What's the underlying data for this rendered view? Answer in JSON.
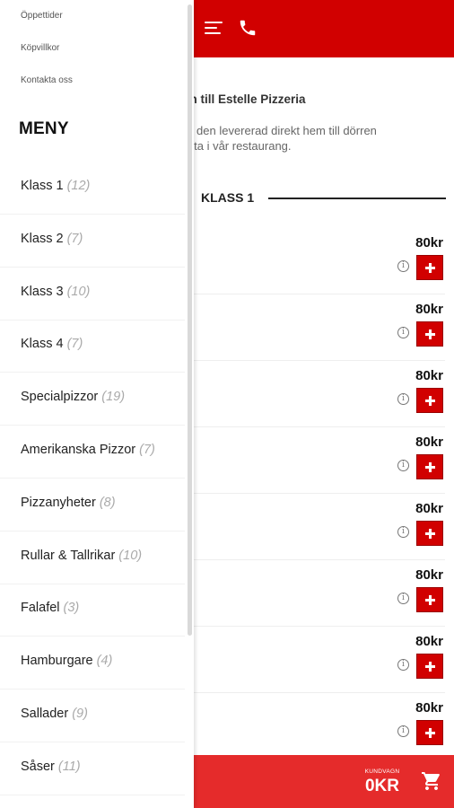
{
  "header": {
    "menu_icon": "hamburger-icon",
    "phone_icon": "phone-icon",
    "accent": "#d10000"
  },
  "welcome": {
    "title": "mmen till Estelle Pizzeria",
    "line1": "och få den levererad direkt hem till dörren",
    "line2": "tt hämta i vår restaurang."
  },
  "section": {
    "title": "KLASS 1"
  },
  "items": [
    {
      "price": "80kr"
    },
    {
      "price": "80kr"
    },
    {
      "price": "80kr"
    },
    {
      "price": "80kr"
    },
    {
      "price": "80kr"
    },
    {
      "price": "80kr"
    },
    {
      "price": "80kr"
    },
    {
      "price": "80kr"
    }
  ],
  "cart": {
    "label": "KUNDVAGN",
    "total": "0KR",
    "icon": "cart-icon",
    "color": "#e52b2b"
  },
  "drawer": {
    "links": [
      "Öppettider",
      "Köpvillkor",
      "Kontakta oss"
    ],
    "menu_title": "MENY",
    "categories": [
      {
        "name": "Klass 1",
        "count": "(12)"
      },
      {
        "name": "Klass 2",
        "count": "(7)"
      },
      {
        "name": "Klass 3",
        "count": "(10)"
      },
      {
        "name": "Klass 4",
        "count": "(7)"
      },
      {
        "name": "Specialpizzor",
        "count": "(19)"
      },
      {
        "name": "Amerikanska Pizzor",
        "count": "(7)"
      },
      {
        "name": "Pizzanyheter",
        "count": "(8)"
      },
      {
        "name": "Rullar & Tallrikar",
        "count": "(10)"
      },
      {
        "name": "Falafel",
        "count": "(3)"
      },
      {
        "name": "Hamburgare",
        "count": "(4)"
      },
      {
        "name": "Sallader",
        "count": "(9)"
      },
      {
        "name": "Såser",
        "count": "(11)"
      }
    ]
  }
}
